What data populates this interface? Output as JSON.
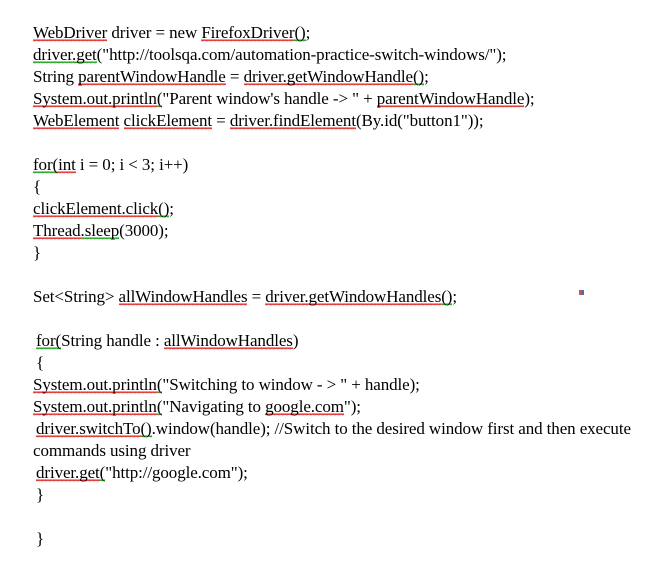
{
  "document": {
    "type": "code-snippet",
    "language": "Java",
    "background_color": "#ffffff",
    "text_color": "#000000",
    "spellcheck_underline_color": "#e01b1b",
    "grammarcheck_underline_color": "#119911",
    "lines": [
      {
        "id": "line-1",
        "text": "WebDriver driver = new FirefoxDriver();",
        "segments": [
          {
            "t": "WebDriver",
            "mark": "red"
          },
          {
            "t": " driver = new ",
            "mark": "none"
          },
          {
            "t": "FirefoxDriver",
            "mark": "red"
          },
          {
            "t": "()",
            "mark": "green"
          },
          {
            "t": ";",
            "mark": "none"
          }
        ]
      },
      {
        "id": "line-2",
        "text": "driver.get(\"http://toolsqa.com/automation-practice-switch-windows/\");",
        "segments": [
          {
            "t": "driver.get",
            "mark": "green"
          },
          {
            "t": "(\"http://toolsqa.com/automation-practice-switch-windows/\");",
            "mark": "none"
          }
        ]
      },
      {
        "id": "line-3",
        "text": "String parentWindowHandle = driver.getWindowHandle();",
        "segments": [
          {
            "t": "String ",
            "mark": "none"
          },
          {
            "t": "parentWindowHandle",
            "mark": "red"
          },
          {
            "t": " = ",
            "mark": "none"
          },
          {
            "t": "driver.getWindowHandle",
            "mark": "red"
          },
          {
            "t": "()",
            "mark": "green"
          },
          {
            "t": ";",
            "mark": "none"
          }
        ]
      },
      {
        "id": "line-4",
        "text": "System.out.println(\"Parent window's handle -> \" + parentWindowHandle);",
        "segments": [
          {
            "t": "System.out.println",
            "mark": "red"
          },
          {
            "t": "(",
            "mark": "green"
          },
          {
            "t": "\"Parent window's handle -> \" + ",
            "mark": "none"
          },
          {
            "t": "parentWindowHandle",
            "mark": "red"
          },
          {
            "t": ");",
            "mark": "none"
          }
        ]
      },
      {
        "id": "line-5",
        "text": "WebElement clickElement = driver.findElement(By.id(\"button1\"));",
        "segments": [
          {
            "t": "WebElement",
            "mark": "red"
          },
          {
            "t": " ",
            "mark": "none"
          },
          {
            "t": "clickElement",
            "mark": "red"
          },
          {
            "t": " = ",
            "mark": "none"
          },
          {
            "t": "driver.findElement",
            "mark": "red"
          },
          {
            "t": "(By.id(\"button1\"));",
            "mark": "none"
          }
        ]
      },
      {
        "id": "line-6",
        "text": "",
        "segments": []
      },
      {
        "id": "line-7",
        "text": "for(int i = 0; i < 3; i++)",
        "segments": [
          {
            "t": "for(",
            "mark": "green"
          },
          {
            "t": "int",
            "mark": "red"
          },
          {
            "t": " i = 0; i < 3; i++)",
            "mark": "none"
          }
        ]
      },
      {
        "id": "line-8",
        "text": "{",
        "segments": [
          {
            "t": "{",
            "mark": "none"
          }
        ]
      },
      {
        "id": "line-9",
        "text": "clickElement.click();",
        "segments": [
          {
            "t": "clickElement.click",
            "mark": "red"
          },
          {
            "t": "()",
            "mark": "green"
          },
          {
            "t": ";",
            "mark": "none"
          }
        ]
      },
      {
        "id": "line-10",
        "text": "Thread.sleep(3000);",
        "segments": [
          {
            "t": "Thread",
            "mark": "red"
          },
          {
            "t": ".sleep",
            "mark": "green"
          },
          {
            "t": "(3000);",
            "mark": "none"
          }
        ]
      },
      {
        "id": "line-11",
        "text": "}",
        "segments": [
          {
            "t": "}",
            "mark": "none"
          }
        ]
      },
      {
        "id": "line-12",
        "text": "",
        "segments": []
      },
      {
        "id": "line-13",
        "text": "Set<String> allWindowHandles = driver.getWindowHandles();",
        "segments": [
          {
            "t": "Set<String> ",
            "mark": "none"
          },
          {
            "t": "allWindowHandles",
            "mark": "red"
          },
          {
            "t": " = ",
            "mark": "none"
          },
          {
            "t": "driver.getWindowHandles",
            "mark": "red"
          },
          {
            "t": "()",
            "mark": "green"
          },
          {
            "t": ";",
            "mark": "none"
          }
        ]
      },
      {
        "id": "line-14",
        "text": "",
        "segments": []
      },
      {
        "id": "line-15",
        "text": "for(String handle : allWindowHandles)",
        "indent": true,
        "segments": [
          {
            "t": "for(",
            "mark": "green"
          },
          {
            "t": "String handle : ",
            "mark": "none"
          },
          {
            "t": "allWindowHandles",
            "mark": "red"
          },
          {
            "t": ")",
            "mark": "none"
          }
        ]
      },
      {
        "id": "line-16",
        "text": "{",
        "indent": true,
        "segments": [
          {
            "t": "{",
            "mark": "none"
          }
        ]
      },
      {
        "id": "line-17",
        "text": "System.out.println(\"Switching to window - > \" + handle);",
        "segments": [
          {
            "t": "System.out.println",
            "mark": "red"
          },
          {
            "t": "(",
            "mark": "green"
          },
          {
            "t": "\"Switching to window - > \" + handle);",
            "mark": "none"
          }
        ]
      },
      {
        "id": "line-18",
        "text": "System.out.println(\"Navigating to google.com\");",
        "segments": [
          {
            "t": "System.out.println",
            "mark": "red"
          },
          {
            "t": "(",
            "mark": "green"
          },
          {
            "t": "\"Navigating to ",
            "mark": "none"
          },
          {
            "t": "google.com",
            "mark": "red"
          },
          {
            "t": "\");",
            "mark": "none"
          }
        ]
      },
      {
        "id": "line-19",
        "text": "driver.switchTo().window(handle); //Switch to the desired window first and then execute commands using driver",
        "wrap": true,
        "segments": [
          {
            "t": "driver.switchTo",
            "mark": "red"
          },
          {
            "t": "()",
            "mark": "green"
          },
          {
            "t": ".window(handle); //Switch to the desired window first and then execute commands using driver",
            "mark": "none"
          }
        ]
      },
      {
        "id": "line-20",
        "text": "driver.get(\"http://google.com\");",
        "indent": true,
        "segments": [
          {
            "t": "driver.get",
            "mark": "red"
          },
          {
            "t": "(",
            "mark": "green"
          },
          {
            "t": "\"http://google.com\");",
            "mark": "none"
          }
        ]
      },
      {
        "id": "line-21",
        "text": "}",
        "indent": true,
        "segments": [
          {
            "t": "}",
            "mark": "none"
          }
        ]
      },
      {
        "id": "line-22",
        "text": "",
        "segments": []
      },
      {
        "id": "line-23",
        "text": "}",
        "indent": true,
        "segments": [
          {
            "t": "}",
            "mark": "none"
          }
        ]
      }
    ]
  }
}
